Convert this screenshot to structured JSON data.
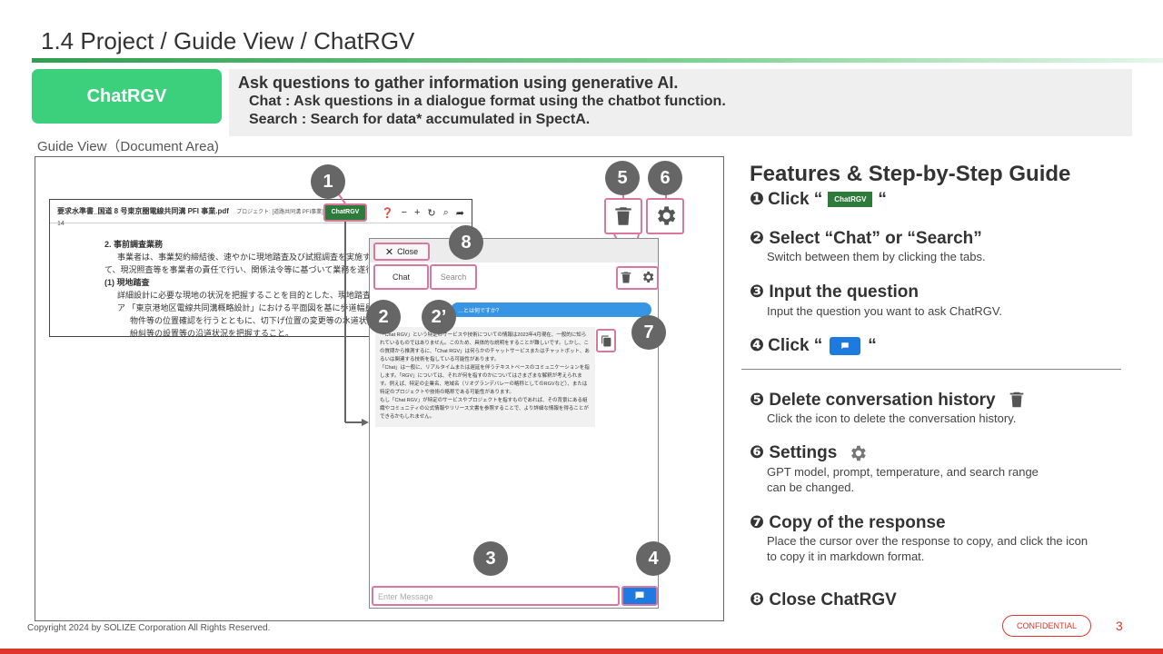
{
  "header": {
    "title": "1.4 Project / Guide View / ChatRGV"
  },
  "pill": {
    "label": "ChatRGV"
  },
  "description": {
    "main": "Ask questions to gather information using generative AI.",
    "chat": "Chat : Ask questions in a dialogue format using the chatbot function.",
    "search": "Search : Search for data* accumulated in SpectA."
  },
  "guide_view_label": "Guide View（Document Area)",
  "document": {
    "filename": "要求水準書_国道 8 号東京圏電線共同溝 PFI 事業.pdf",
    "project_label": "プロジェクト: [道路共同溝 PFI事業] _国道 8 号東京港",
    "page_number": "14",
    "chatrgv_button": "ChatRGV",
    "lines": [
      "2. 事前調査業務",
      "事業者は、事業契約締結後、速やかに現地踏査及び試掘調査を実施することとし",
      "て、現況照査等を事業者の責任で行い、関係法令等に基づいて業務を遂行するも",
      "(1) 現地踏査",
      "詳細設計に必要な現地の状況を把握することを目的とした、現地踏査を行うこ",
      "ア 「東京港地区電線共同溝概略設計」における平面図を基に歩道幅員、官民",
      "物件等の位置確認を行うとともに、切下げ位置の変更等の水道状況およ",
      "紛糾等の設置等の沿道状況を把握すること。"
    ]
  },
  "panel": {
    "close_label": "Close",
    "tabs": {
      "chat": "Chat",
      "search": "Search"
    },
    "user_message": "…とは何ですか？",
    "response": [
      "「Chat RGV」という特定のサービスや技術についての情報は2023年4月現在、一般的に知られているものではありません。このため、具体的な説明をすることが難しいです。しかし、この質問から推測するに、「Chat RGV」は何らかのチャットサービスまたはチャットボット、あるいは関連する技術を指している可能性があります。",
      "「Chat」は一般に、リアルタイムまたは遅延を伴うテキストベースのコミュニケーションを指します。「RGV」については、それが何を指すのかについてはさまざまな解釈が考えられます。例えば、特定の企業名、地域名（リオグランデバレーの略称としてのRGVなど）、または特定のプロジェクトや技術の略称である可能性があります。",
      "もし「Chat RGV」が特定のサービスやプロジェクトを指すものであれば、その背景にある組織やコミュニティの公式情報やリリース文書を参照することで、より詳細な情報を得ることができるかもしれません。"
    ],
    "input_placeholder": "Enter Message"
  },
  "badges": {
    "b1": "1",
    "b2": "2",
    "b2p": "2’",
    "b3": "3",
    "b4": "4",
    "b5": "5",
    "b6": "6",
    "b7": "7",
    "b8": "8"
  },
  "features": {
    "title": "Features & Step-by-Step Guide",
    "step1": {
      "num": "❶",
      "prefix": "Click “",
      "chip": "ChatRGV",
      "suffix": "“"
    },
    "step2": {
      "text": "❷ Select “Chat” or “Search”",
      "sub": "Switch between them by clicking the tabs."
    },
    "step3": {
      "text": "❸ Input the question",
      "sub": "Input the question you want to ask ChatRGV."
    },
    "step4": {
      "num": "❹",
      "prefix": "Click “",
      "suffix": "“"
    },
    "step5": {
      "text": "❺ Delete conversation history",
      "sub": "Click the icon to delete the conversation history."
    },
    "step6": {
      "text": "❻ Settings",
      "sub1": "GPT model, prompt, temperature, and search range",
      "sub2": "can be changed."
    },
    "step7": {
      "text": "❼ Copy of the response",
      "sub1": "Place the cursor over the response to copy, and click the icon",
      "sub2": "to copy it in markdown format."
    },
    "step8": {
      "text": "❽ Close ChatRGV"
    }
  },
  "footer": {
    "copyright": "Copyright 2024 by SOLIZE Corporation All Rights Reserved.",
    "confidential": "CONFIDENTIAL",
    "page": "3"
  },
  "colors": {
    "accent_green": "#3ccf7c",
    "chip_green": "#2d7a3a",
    "highlight_pink": "#d9789e",
    "send_blue": "#1f7ae0",
    "footer_red": "#e0352b"
  }
}
